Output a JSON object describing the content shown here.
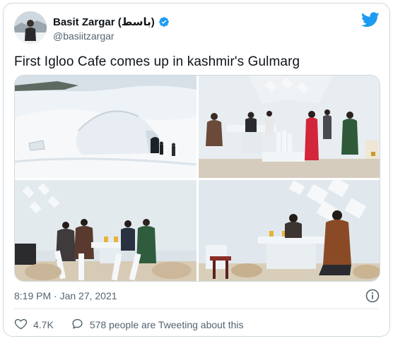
{
  "tweet": {
    "author": {
      "display_name": "Basit Zargar (باسط)",
      "handle": "@basiitzargar",
      "verified": true,
      "avatar_icon": "avatar-person-in-snow"
    },
    "brand_icon": "twitter-bird-icon",
    "brand_color": "#1d9bf0",
    "text": "First Igloo Cafe comes up in kashmir's Gulmarg",
    "photos": [
      {
        "subject": "igloo exterior in snow with people walking"
      },
      {
        "subject": "people seated at ice tables inside igloo"
      },
      {
        "subject": "family at ice table inside igloo"
      },
      {
        "subject": "couple at ice table inside igloo"
      }
    ],
    "timestamp": "8:19 PM · Jan 27, 2021",
    "likes": "4.7K",
    "conversation_text": "578 people are Tweeting about this"
  }
}
